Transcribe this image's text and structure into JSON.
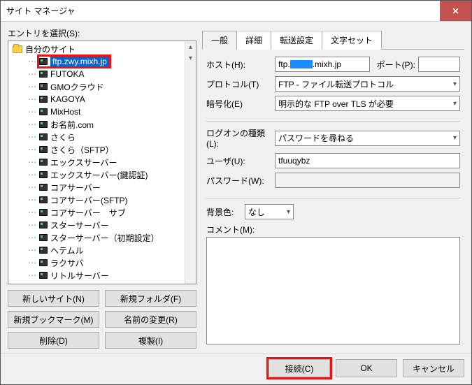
{
  "window": {
    "title": "サイト マネージャ"
  },
  "left": {
    "entryLabel": "エントリを選択(S):",
    "rootFolder": "自分のサイト",
    "selected": "ftp.zwy.mixh.jp",
    "items": [
      "FUTOKA",
      "GMOクラウド",
      "KAGOYA",
      "MixHost",
      "お名前.com",
      "さくら",
      "さくら（SFTP）",
      "エックスサーバー",
      "エックスサーバー(鍵認証)",
      "コアサーバー",
      "コアサーバー(SFTP)",
      "コアサーバー　サブ",
      "スターサーバー",
      "スターサーバー（初期設定）",
      "ヘテムル",
      "ラクサバ",
      "リトルサーバー"
    ],
    "buttons": {
      "newSite": "新しいサイト(N)",
      "newFolder": "新規フォルダ(F)",
      "newBookmark": "新規ブックマーク(M)",
      "rename": "名前の変更(R)",
      "delete": "削除(D)",
      "copy": "複製(I)"
    }
  },
  "tabs": {
    "general": "一般",
    "detail": "詳細",
    "transfer": "転送設定",
    "charset": "文字セット"
  },
  "form": {
    "hostLabel": "ホスト(H):",
    "hostPre": "ftp.",
    "hostSuf": ".mixh.jp",
    "portLabel": "ポート(P):",
    "protoLabel": "プロトコル(T)",
    "protoValue": "FTP - ファイル転送プロトコル",
    "encLabel": "暗号化(E)",
    "encValue": "明示的な FTP over TLS が必要",
    "logonLabel": "ログオンの種類(L):",
    "logonValue": "パスワードを尋ねる",
    "userLabel": "ユーザ(U):",
    "userValue": "tfuuqybz",
    "passLabel": "パスワード(W):",
    "bgLabel": "背景色:",
    "bgValue": "なし",
    "commentLabel": "コメント(M):"
  },
  "footer": {
    "connect": "接続(C)",
    "ok": "OK",
    "cancel": "キャンセル"
  }
}
